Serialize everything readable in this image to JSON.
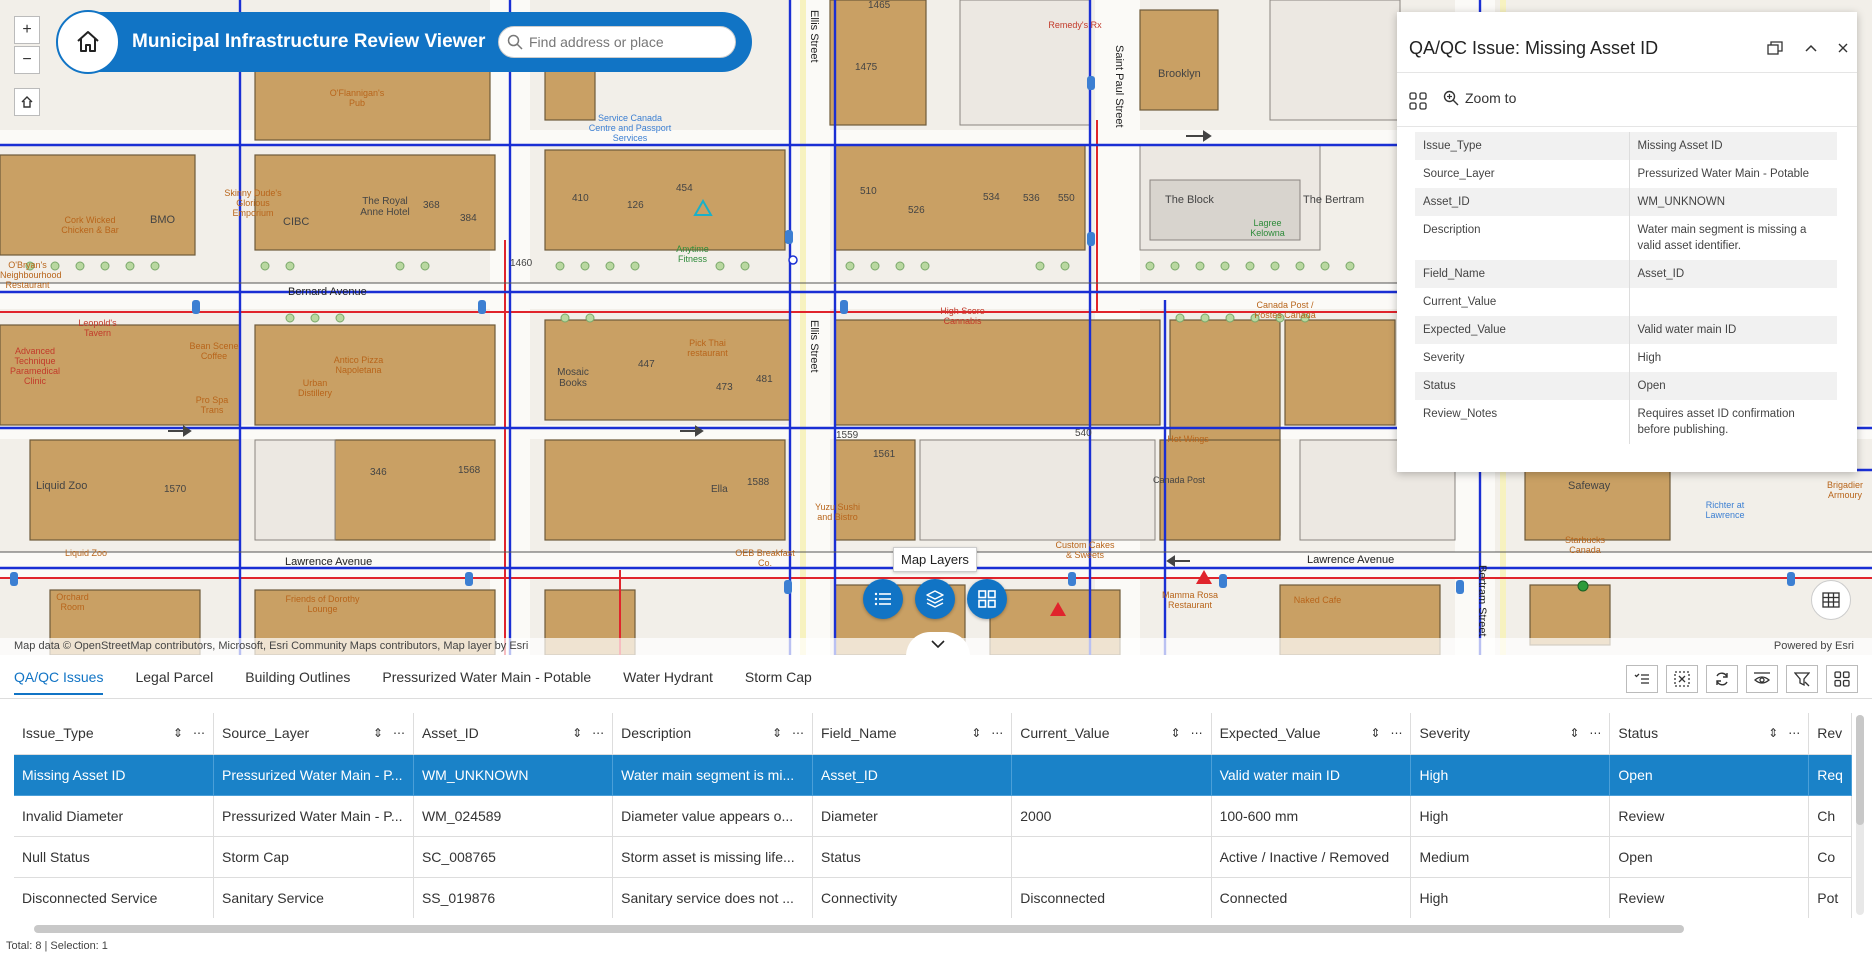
{
  "app": {
    "title": "Municipal Infrastructure Review Viewer",
    "search_placeholder": "Find address or place"
  },
  "map": {
    "attribution": "Map data © OpenStreetMap contributors, Microsoft, Esri Community Maps contributors, Map layer by Esri",
    "powered_by": "Powered by Esri",
    "tooltip": "Map Layers",
    "streets": [
      "Bernard Avenue",
      "Lawrence Avenue",
      "Lawrence Avenue",
      "Ellis Street",
      "Ellis Street",
      "Saint Paul Street",
      "Bertram Street"
    ],
    "labels": {
      "brooklyn": "Brooklyn",
      "the_block": "The Block",
      "the_bertram": "The Bertram",
      "bmo": "BMO",
      "cibc": "CIBC",
      "royal_anne": "The Royal Anne Hotel",
      "mosaic": "Mosaic Books",
      "ella": "Ella",
      "liquid_zoo": "Liquid Zoo",
      "safeway": "Safeway",
      "canada_post": "Canada Post",
      "n1465": "1465",
      "n1475": "1475",
      "n410": "410",
      "n126": "126",
      "n454": "454",
      "n510": "510",
      "n526": "526",
      "n534": "534",
      "n536": "536",
      "n550": "550",
      "n368": "368",
      "n384": "384",
      "n447": "447",
      "n473": "473",
      "n481": "481",
      "n346": "346",
      "n1568": "1568",
      "n1588": "1588",
      "n1561": "1561",
      "n1570": "1570",
      "n540": "540",
      "n1559": "1559",
      "n1460": "1460"
    },
    "pois": {
      "service_canada": "Service Canada Centre and Passport Services",
      "skinny_dudes": "Skinny Dude's Glorious Emporium",
      "o_flannigans": "O'Flannigan's Pub",
      "anytime_fitness": "Anytime Fitness",
      "remedys": "Remedy's Rx",
      "lagree": "Lagree Kelowna",
      "leopolds": "Leopold's Tavern",
      "advanced": "Advanced Technique Paramedical Clinic",
      "bean_scene": "Bean Scene Coffee",
      "urban": "Urban Distillery",
      "antico": "Antico Pizza Napoletana",
      "pick_thai": "Pick Thai restaurant",
      "high_score": "High Score Cannabis",
      "canada_post2": "Canada Post / Postes Canada",
      "hot_wings": "Hot Wings",
      "yuzu": "Yuzu Sushi and Bistro",
      "custom_cakes": "Custom Cakes & Sweets",
      "oeb": "OEB Breakfast Co.",
      "friends": "Friends of Dorothy Lounge",
      "orchard": "Orchard Room",
      "mamma_rosa": "Mamma Rosa Restaurant",
      "naked_cafe": "Naked Cafe",
      "starbucks": "Starbucks Canada",
      "richter": "Richter at Lawrence",
      "brigadier": "Brigadier Armoury",
      "pro_spa": "Pro Spa Trans",
      "liquid_zoo2": "Liquid Zoo",
      "obryans": "O'Bryan's Neighbourhood Restaurant",
      "cork": "Cork Wicked Chicken & Bar"
    }
  },
  "popup": {
    "title": "QA/QC Issue: Missing Asset ID",
    "zoom_to": "Zoom to",
    "fields": [
      {
        "key": "Issue_Type",
        "value": "Missing Asset ID"
      },
      {
        "key": "Source_Layer",
        "value": "Pressurized Water Main - Potable"
      },
      {
        "key": "Asset_ID",
        "value": "WM_UNKNOWN"
      },
      {
        "key": "Description",
        "value": "Water main segment is missing a valid asset identifier."
      },
      {
        "key": "Field_Name",
        "value": "Asset_ID"
      },
      {
        "key": "Current_Value",
        "value": ""
      },
      {
        "key": "Expected_Value",
        "value": "Valid water main ID"
      },
      {
        "key": "Severity",
        "value": "High"
      },
      {
        "key": "Status",
        "value": "Open"
      },
      {
        "key": "Review_Notes",
        "value": "Requires asset ID confirmation before publishing."
      }
    ]
  },
  "table": {
    "tabs": [
      "QA/QC Issues",
      "Legal Parcel",
      "Building Outlines",
      "Pressurized Water Main - Potable",
      "Water Hydrant",
      "Storm Cap"
    ],
    "active_tab": "QA/QC Issues",
    "columns": [
      "Issue_Type",
      "Source_Layer",
      "Asset_ID",
      "Description",
      "Field_Name",
      "Current_Value",
      "Expected_Value",
      "Severity",
      "Status",
      "Rev"
    ],
    "rows": [
      [
        "Missing Asset ID",
        "Pressurized Water Main - P...",
        "WM_UNKNOWN",
        "Water main segment is mi...",
        "Asset_ID",
        "",
        "Valid water main ID",
        "High",
        "Open",
        "Req"
      ],
      [
        "Invalid Diameter",
        "Pressurized Water Main - P...",
        "WM_024589",
        "Diameter value appears o...",
        "Diameter",
        "2000",
        "100-600 mm",
        "High",
        "Review",
        "Ch"
      ],
      [
        "Null Status",
        "Storm Cap",
        "SC_008765",
        "Storm asset is missing life...",
        "Status",
        "",
        "Active / Inactive / Removed",
        "Medium",
        "Open",
        "Co"
      ],
      [
        "Disconnected Service",
        "Sanitary Service",
        "SS_019876",
        "Sanitary service does not ...",
        "Connectivity",
        "Disconnected",
        "Connected",
        "High",
        "Review",
        "Pot"
      ]
    ],
    "selected_row": 0,
    "status": "Total: 8 | Selection: 1"
  },
  "colors": {
    "brand": "#1174c5",
    "selected_row": "#1a82c8",
    "building": "#c9a064",
    "water_main": "#1a2fd4",
    "sanitary": "#e0242c"
  }
}
